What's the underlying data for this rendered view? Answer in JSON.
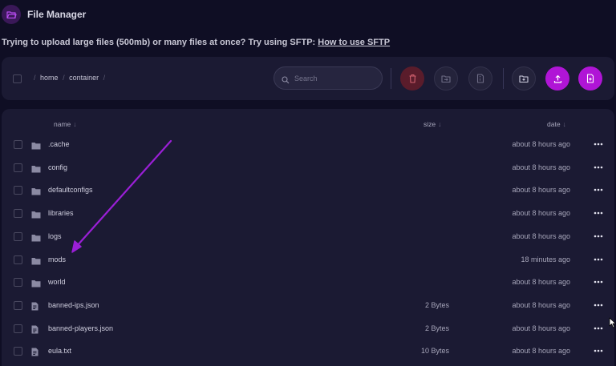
{
  "app": {
    "title": "File Manager",
    "icon": "folder-open-icon"
  },
  "notice": {
    "text": "Trying to upload large files (500mb) or many files at once? Try using SFTP:",
    "link": "How to use SFTP"
  },
  "toolbar": {
    "breadcrumb": [
      "home",
      "container"
    ],
    "search_placeholder": "Search",
    "buttons": [
      {
        "name": "delete-button",
        "icon": "trash-icon"
      },
      {
        "name": "move-button",
        "icon": "folder-move-icon"
      },
      {
        "name": "archive-button",
        "icon": "file-zip-icon"
      },
      {
        "name": "new-folder-button",
        "icon": "folder-plus-icon"
      },
      {
        "name": "upload-button",
        "icon": "upload-icon"
      },
      {
        "name": "new-file-button",
        "icon": "file-plus-icon"
      }
    ]
  },
  "table": {
    "columns": {
      "name": "name",
      "size": "size",
      "date": "date"
    },
    "rows": [
      {
        "type": "folder",
        "name": ".cache",
        "size": "",
        "date": "about 8 hours ago"
      },
      {
        "type": "folder",
        "name": "config",
        "size": "",
        "date": "about 8 hours ago"
      },
      {
        "type": "folder",
        "name": "defaultconfigs",
        "size": "",
        "date": "about 8 hours ago"
      },
      {
        "type": "folder",
        "name": "libraries",
        "size": "",
        "date": "about 8 hours ago"
      },
      {
        "type": "folder",
        "name": "logs",
        "size": "",
        "date": "about 8 hours ago"
      },
      {
        "type": "folder",
        "name": "mods",
        "size": "",
        "date": "18 minutes ago"
      },
      {
        "type": "folder",
        "name": "world",
        "size": "",
        "date": "about 8 hours ago"
      },
      {
        "type": "file",
        "name": "banned-ips.json",
        "size": "2 Bytes",
        "date": "about 8 hours ago"
      },
      {
        "type": "file",
        "name": "banned-players.json",
        "size": "2 Bytes",
        "date": "about 8 hours ago"
      },
      {
        "type": "file",
        "name": "eula.txt",
        "size": "10 Bytes",
        "date": "about 8 hours ago"
      }
    ]
  },
  "colors": {
    "background": "#0f0e24",
    "panel": "#1b1a33",
    "accent": "#b015d6",
    "danger": "#5a1c2b",
    "annotation_arrow": "#9a1fd6"
  }
}
